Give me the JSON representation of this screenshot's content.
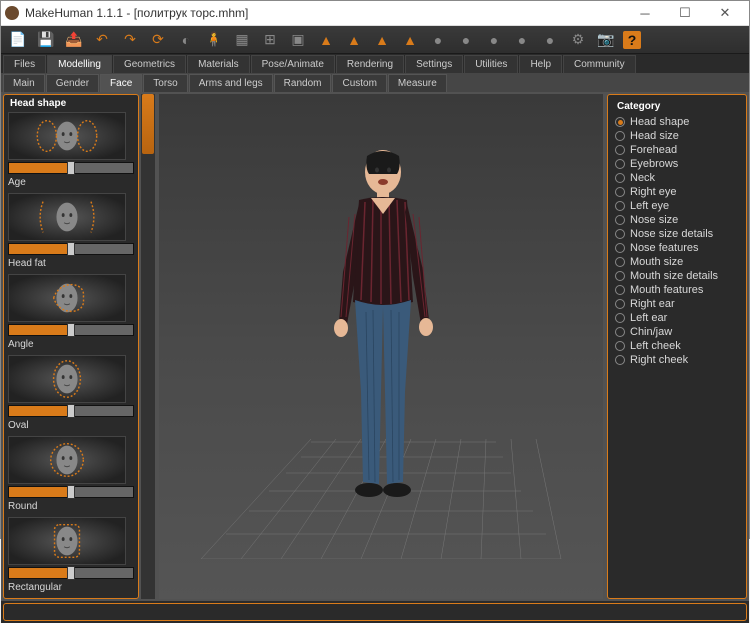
{
  "window": {
    "title": "MakeHuman 1.1.1 - [политрук торс.mhm]"
  },
  "toolbar_icons": [
    "file",
    "save",
    "export",
    "undo",
    "redo",
    "refresh",
    "smooth",
    "wire",
    "camera",
    "grid",
    "checker",
    "a1",
    "a2",
    "a3",
    "a4",
    "s1",
    "s2",
    "s3",
    "s4",
    "s5",
    "gear",
    "cam2"
  ],
  "tabs": {
    "items": [
      "Files",
      "Modelling",
      "Geometrics",
      "Materials",
      "Pose/Animate",
      "Rendering",
      "Settings",
      "Utilities",
      "Help",
      "Community"
    ],
    "active": "Modelling"
  },
  "subtabs": {
    "items": [
      "Main",
      "Gender",
      "Face",
      "Torso",
      "Arms and legs",
      "Random",
      "Custom",
      "Measure"
    ],
    "active": "Face"
  },
  "left_panel": {
    "header": "Head shape",
    "items": [
      {
        "label": "Age"
      },
      {
        "label": "Head fat"
      },
      {
        "label": "Angle"
      },
      {
        "label": "Oval"
      },
      {
        "label": "Round"
      },
      {
        "label": "Rectangular"
      }
    ]
  },
  "right_panel": {
    "header": "Category",
    "items": [
      "Head shape",
      "Head size",
      "Forehead",
      "Eyebrows",
      "Neck",
      "Right eye",
      "Left eye",
      "Nose size",
      "Nose size details",
      "Nose features",
      "Mouth size",
      "Mouth size details",
      "Mouth features",
      "Right ear",
      "Left ear",
      "Chin/jaw",
      "Left cheek",
      "Right cheek"
    ],
    "selected": "Head shape"
  }
}
